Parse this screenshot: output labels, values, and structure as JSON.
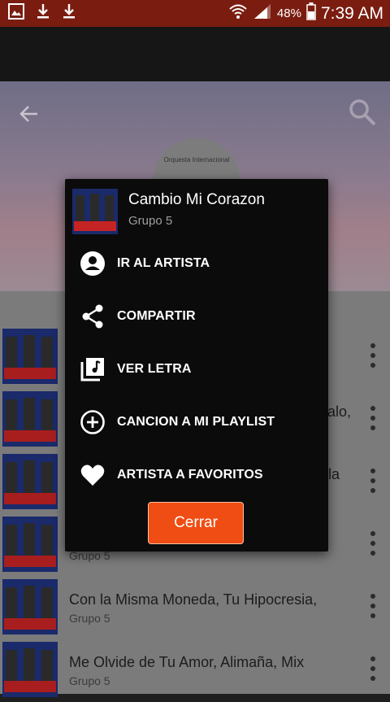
{
  "status_bar": {
    "battery_percent": "48%",
    "time": "7:39 AM",
    "icons": [
      "image-icon",
      "download-icon",
      "download-icon",
      "wifi-icon",
      "signal-icon",
      "battery-icon"
    ]
  },
  "hero": {
    "logo_caption": "Orquesta Internacional",
    "back_icon": "arrow-left-icon",
    "search_icon": "search-icon"
  },
  "dialog": {
    "title": "Cambio Mi Corazon",
    "artist": "Grupo 5",
    "menu": [
      {
        "label": "IR AL ARTISTA",
        "icon": "account-circle-icon"
      },
      {
        "label": "COMPARTIR",
        "icon": "share-icon"
      },
      {
        "label": "VER LETRA",
        "icon": "lyrics-icon"
      },
      {
        "label": "CANCION A MI PLAYLIST",
        "icon": "add-circle-icon"
      },
      {
        "label": "ARTISTA A FAVORITOS",
        "icon": "heart-icon"
      }
    ],
    "close_label": "Cerrar"
  },
  "list": {
    "rows": [
      {
        "title": "",
        "artist": ""
      },
      {
        "title": "alo,",
        "artist": ""
      },
      {
        "title": "la",
        "artist": ""
      },
      {
        "title": "",
        "artist": "Grupo 5"
      },
      {
        "title": "Con la Misma Moneda, Tu Hipocresia,",
        "artist": "Grupo 5"
      },
      {
        "title": "Me Olvide de Tu Amor, Alimaña, Mix",
        "artist": "Grupo 5"
      }
    ]
  },
  "colors": {
    "status_bar": "#7a1d10",
    "accent": "#ef4d13",
    "dialog_bg": "#0b0b0b"
  }
}
